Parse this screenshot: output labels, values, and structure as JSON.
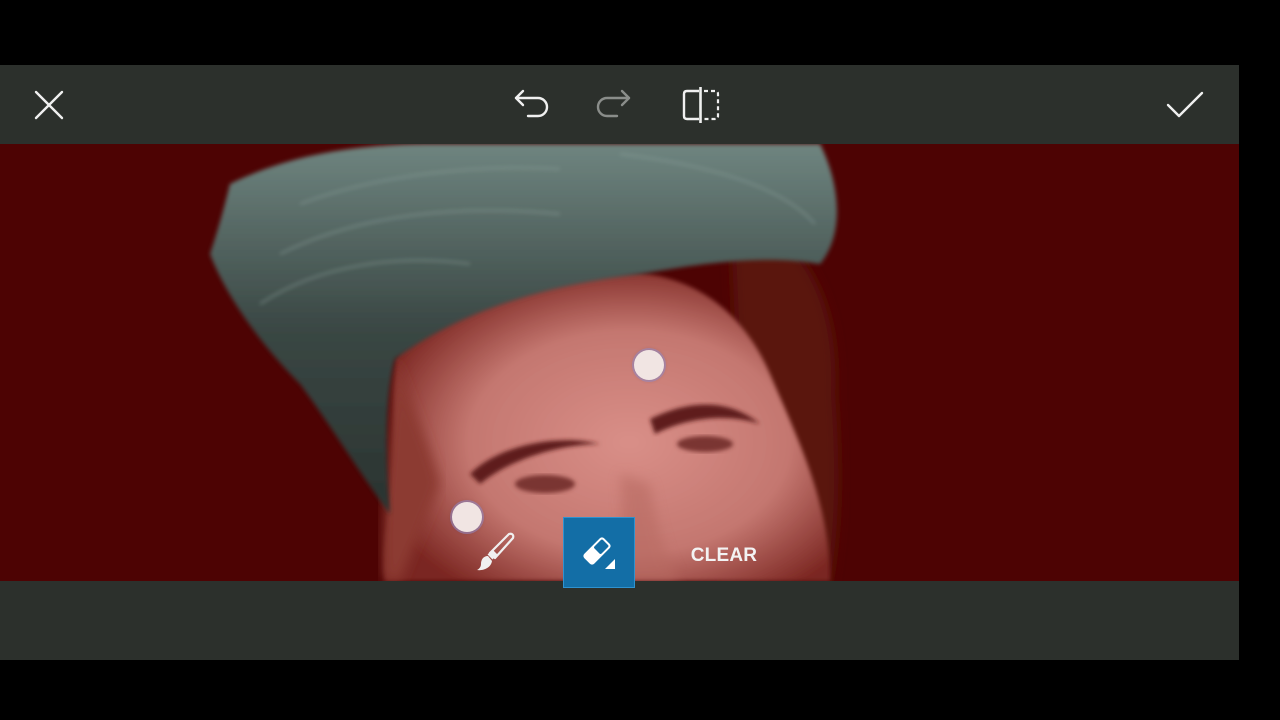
{
  "topbar": {
    "close_icon": "close-icon",
    "undo_icon": "undo-icon",
    "redo_icon": "redo-icon",
    "compare_icon": "compare-icon",
    "apply_icon": "checkmark-icon",
    "redo_enabled": false
  },
  "canvas": {
    "content": "Portrait photo with red mask overlay; hair area unmasked",
    "mask_color": "#4d0303",
    "handles": [
      {
        "name": "mask-handle-1"
      },
      {
        "name": "mask-handle-2"
      }
    ]
  },
  "bottombar": {
    "tools": [
      {
        "name": "brush",
        "icon": "brush-icon",
        "selected": false
      },
      {
        "name": "eraser",
        "icon": "eraser-icon",
        "selected": true
      }
    ],
    "clear_label": "CLEAR"
  },
  "colors": {
    "toolbar_bg": "#2c302c",
    "accent": "#136ea6",
    "icon_color": "#f0f0f0",
    "disabled_icon_color": "#8a8d8a"
  }
}
